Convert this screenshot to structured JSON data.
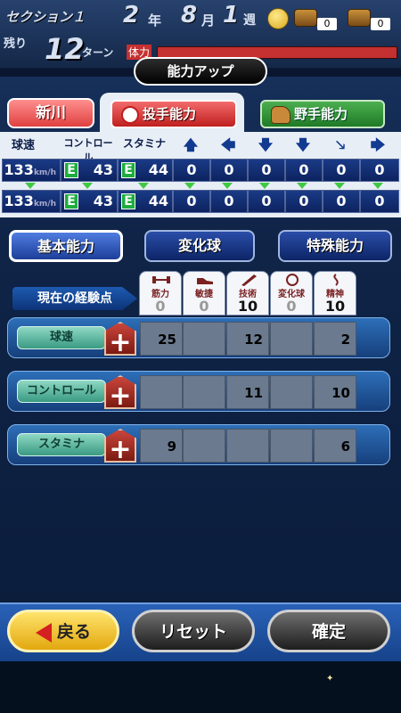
{
  "header": {
    "section": "セクション１",
    "year_num": "2",
    "year_unit": "年",
    "month_num": "8",
    "month_unit": "月",
    "week_num": "1",
    "week_unit": "週",
    "chest1_count": "0",
    "chest2_count": "0",
    "remaining_label": "残り",
    "turns_num": "12",
    "turns_unit": "ターン",
    "stamina_label": "体力"
  },
  "panel": {
    "title": "能力アップ",
    "player_name": "新川",
    "tabs": {
      "pitcher": "投手能力",
      "fielder": "野手能力"
    }
  },
  "stats": {
    "headers": {
      "velocity": "球速",
      "control": "コントロール",
      "stamina": "スタミナ"
    },
    "unit": "km/h",
    "arrow_icons": [
      "arrow-up-icon",
      "arrow-left-icon",
      "arrow-down-left-icon",
      "arrow-down-icon",
      "arrow-down-right-icon",
      "arrow-right-icon"
    ],
    "arrow_glyphs": [
      "🡅",
      "🡄",
      "🡇",
      "🡇",
      "🡖",
      "🡆"
    ],
    "rows": [
      {
        "velocity": "133",
        "control_grade": "E",
        "control": "43",
        "stamina_grade": "E",
        "stamina": "44",
        "pitches": [
          "0",
          "0",
          "0",
          "0",
          "0",
          "0"
        ]
      },
      {
        "velocity": "133",
        "control_grade": "E",
        "control": "43",
        "stamina_grade": "E",
        "stamina": "44",
        "pitches": [
          "0",
          "0",
          "0",
          "0",
          "0",
          "0"
        ]
      }
    ]
  },
  "categories": {
    "basic": "基本能力",
    "breaking": "変化球",
    "special": "特殊能力"
  },
  "experience": {
    "label": "現在の経験点",
    "columns": [
      {
        "label": "筋力",
        "value": "0",
        "icon": "dumbbell-icon"
      },
      {
        "label": "敏捷",
        "value": "0",
        "icon": "shoe-icon"
      },
      {
        "label": "技術",
        "value": "10",
        "icon": "bat-icon"
      },
      {
        "label": "変化球",
        "value": "0",
        "icon": "baseball-icon"
      },
      {
        "label": "精神",
        "value": "10",
        "icon": "spirit-icon"
      }
    ]
  },
  "abilities": [
    {
      "name": "球速",
      "costs": [
        "25",
        "",
        "12",
        "",
        "2"
      ]
    },
    {
      "name": "コントロール",
      "costs": [
        "",
        "",
        "11",
        "",
        "10"
      ]
    },
    {
      "name": "スタミナ",
      "costs": [
        "9",
        "",
        "",
        "",
        "6"
      ]
    }
  ],
  "bottom": {
    "back": "戻る",
    "reset": "リセット",
    "confirm": "確定"
  }
}
